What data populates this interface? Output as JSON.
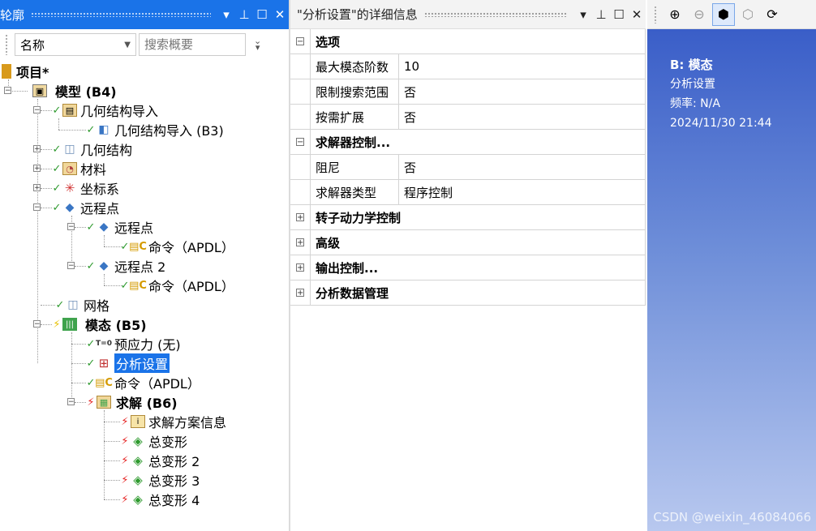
{
  "outline": {
    "title": "轮廓",
    "filter": {
      "selected": "名称",
      "search_placeholder": "搜索概要"
    },
    "tree": {
      "project": "项目*",
      "model": "模型 (B4)",
      "geom_import": "几何结构导入",
      "geom_import_b3": "几何结构导入 (B3)",
      "geometry": "几何结构",
      "materials": "材料",
      "coords": "坐标系",
      "remote_points": "远程点",
      "remote_point_1": "远程点",
      "command_1": "命令（APDL）",
      "remote_point_2": "远程点 2",
      "command_2": "命令（APDL）",
      "mesh": "网格",
      "modal": "模态 (B5)",
      "prestress": "预应力 (无)",
      "analysis_settings": "分析设置",
      "command_3": "命令（APDL）",
      "solution": "求解 (B6)",
      "solution_info": "求解方案信息",
      "total_def_1": "总变形",
      "total_def_2": "总变形 2",
      "total_def_3": "总变形 3",
      "total_def_4": "总变形 4"
    }
  },
  "details": {
    "title": "\"分析设置\"的详细信息",
    "sections": {
      "options": "选项",
      "max_modes_key": "最大模态阶数",
      "max_modes_val": "10",
      "limit_range_key": "限制搜索范围",
      "limit_range_val": "否",
      "on_demand_key": "按需扩展",
      "on_demand_val": "否",
      "solver_controls": "求解器控制...",
      "damping_key": "阻尼",
      "damping_val": "否",
      "solver_type_key": "求解器类型",
      "solver_type_val": "程序控制",
      "rotordynamics": "转子动力学控制",
      "advanced": "高级",
      "output_controls": "输出控制...",
      "data_management": "分析数据管理"
    }
  },
  "graphics": {
    "info": {
      "heading": "B: 模态",
      "line1": "分析设置",
      "line2": "频率: N/A",
      "line3": "2024/11/30 21:44"
    },
    "watermark": "CSDN @weixin_46084066"
  },
  "colors": {
    "accent": "#1a73e8",
    "check": "#2e9a2e",
    "bolt": "#e52222"
  }
}
